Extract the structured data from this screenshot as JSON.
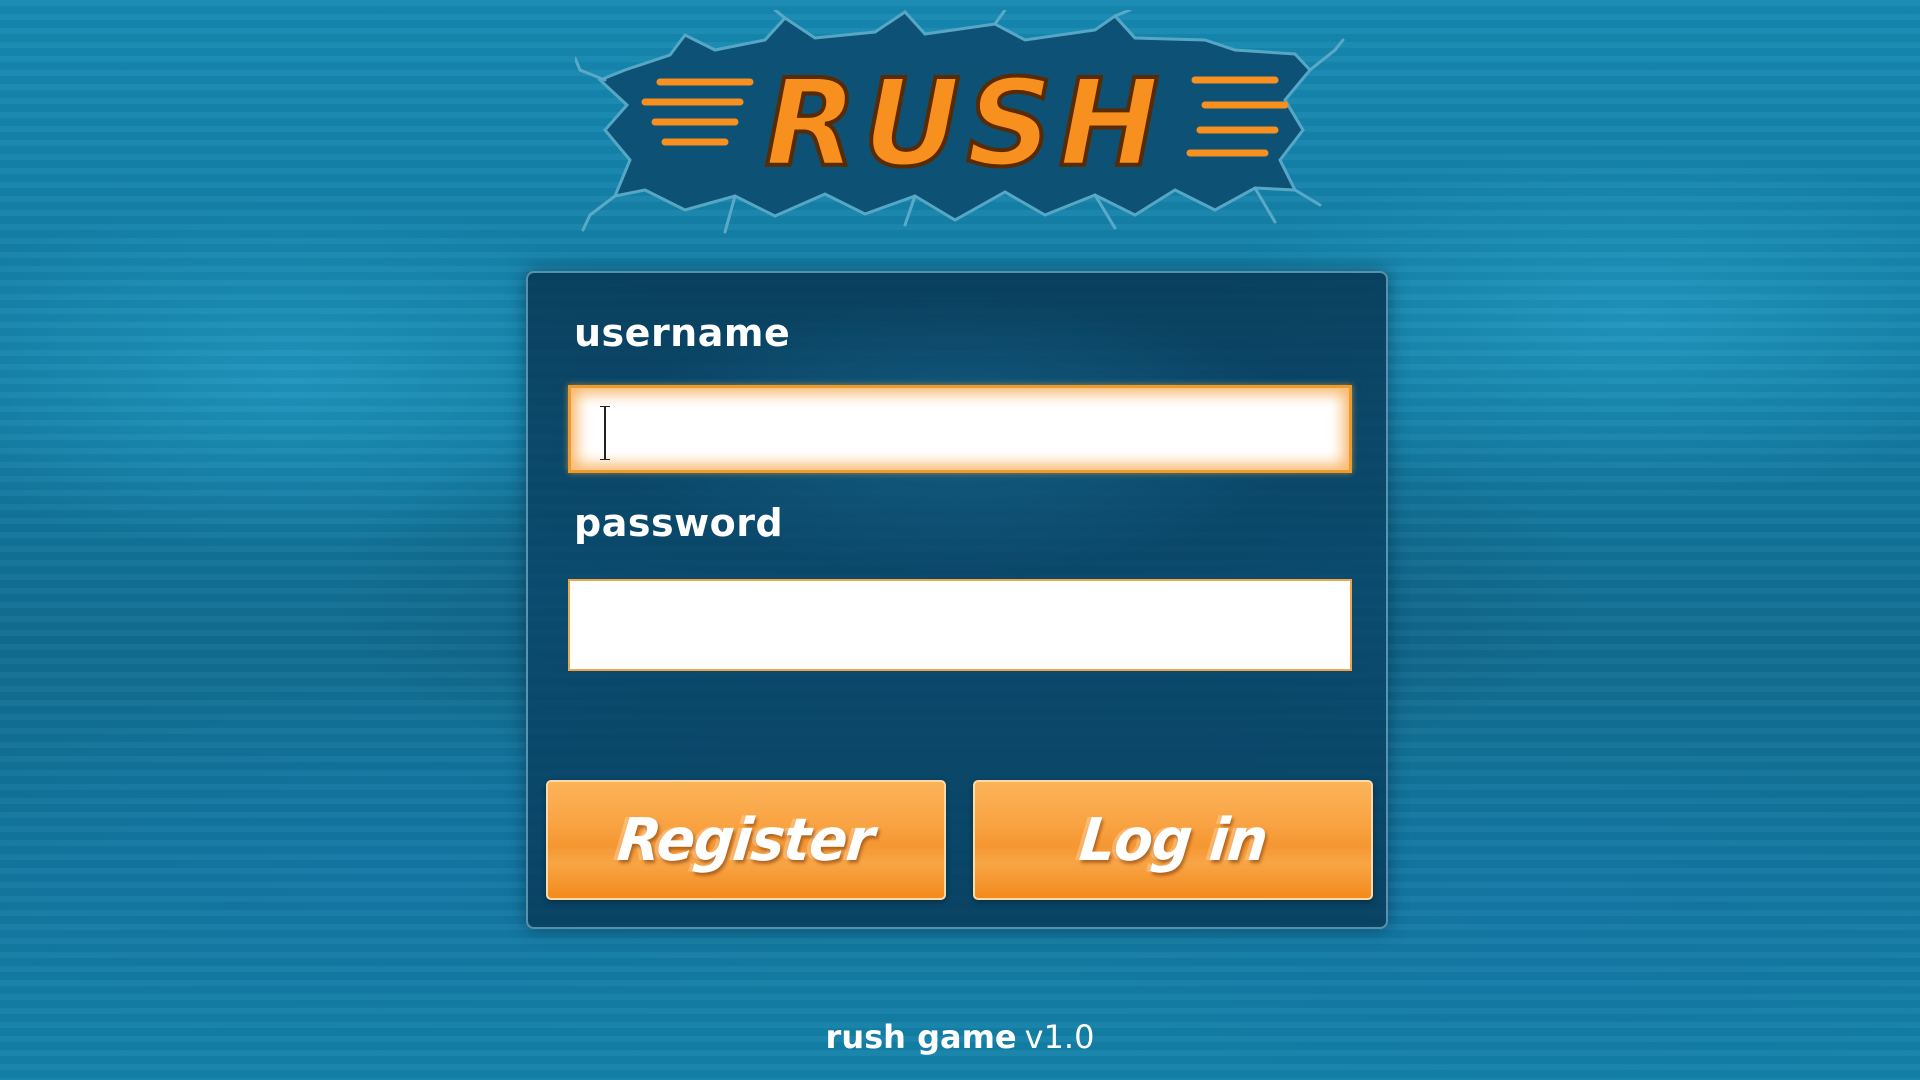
{
  "logo": {
    "text": "RUSH",
    "icon": "rush-logo",
    "text_color": "#f7901e",
    "splat_color": "#0d4f73"
  },
  "login": {
    "username_label": "username",
    "username_value": "",
    "password_label": "password",
    "password_value": "",
    "register_label": "Register",
    "login_label": "Log in"
  },
  "footer": {
    "name": "rush game",
    "version": "v1.0"
  },
  "colors": {
    "background": "#137aa1",
    "panel": "#0a4669",
    "accent": "#f59732",
    "field_focus_glow": "#f19a2c"
  }
}
